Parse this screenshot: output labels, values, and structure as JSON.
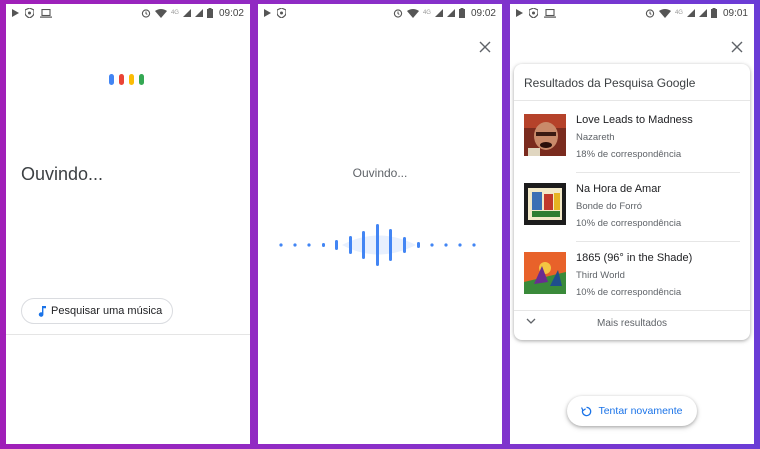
{
  "colors": {
    "google_blue": "#4285f4",
    "google_red": "#ea4335",
    "google_yellow": "#fbbc05",
    "google_green": "#34a853",
    "link_blue": "#1a73e8",
    "background_purple": "#a01fb8"
  },
  "screens": [
    {
      "status": {
        "time": "09:02",
        "network": "4G"
      },
      "listening_label": "Ouvindo...",
      "song_search_button": {
        "label": "Pesquisar uma música",
        "icon": "music-note-icon"
      }
    },
    {
      "status": {
        "time": "09:02",
        "network": "4G"
      },
      "close_icon": "close-icon",
      "listening_label": "Ouvindo..."
    },
    {
      "status": {
        "time": "09:01",
        "network": "4G"
      },
      "close_icon": "close-icon",
      "results_title": "Resultados da Pesquisa Google",
      "results": [
        {
          "title": "Love Leads to Madness",
          "artist": "Nazareth",
          "match": "18% de correspondência"
        },
        {
          "title": "Na Hora de Amar",
          "artist": "Bonde do Forró",
          "match": "10% de correspondência"
        },
        {
          "title": "1865 (96° in the Shade)",
          "artist": "Third World",
          "match": "10% de correspondência"
        }
      ],
      "more_results": "Mais resultados",
      "retry_button": {
        "label": "Tentar novamente",
        "icon": "refresh-icon"
      }
    }
  ]
}
